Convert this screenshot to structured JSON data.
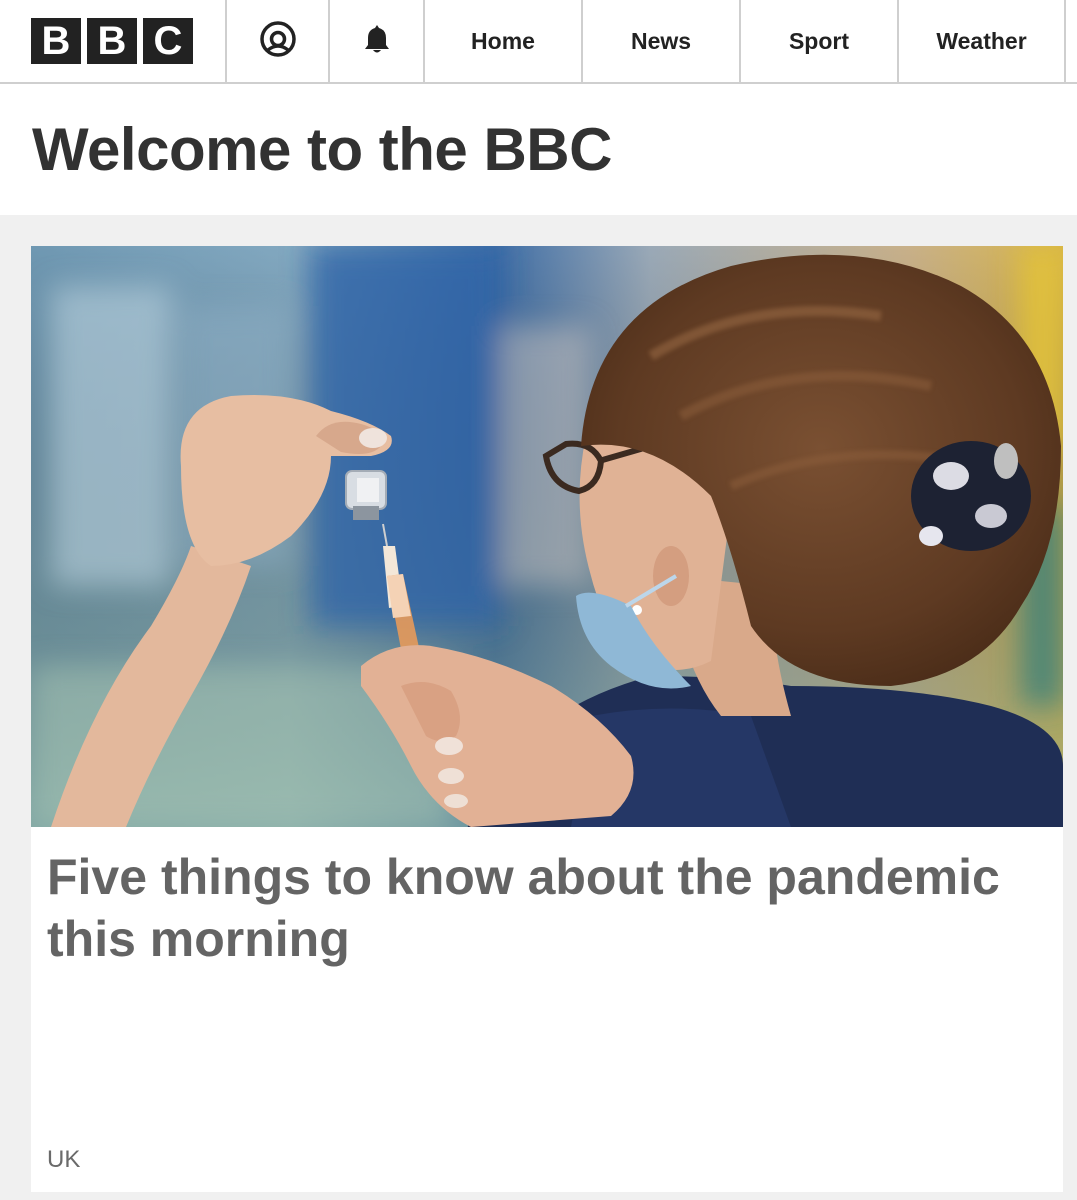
{
  "header": {
    "logo_letters": [
      "B",
      "B",
      "C"
    ],
    "icons": {
      "account": "account-icon",
      "notifications": "bell-icon"
    },
    "nav": [
      {
        "label": "Home"
      },
      {
        "label": "News"
      },
      {
        "label": "Sport"
      },
      {
        "label": "Weather"
      }
    ]
  },
  "page": {
    "title": "Welcome to the BBC"
  },
  "promo": {
    "image_subject": "vaccine-preparation-photo",
    "headline": "Five things to know about the pandemic this morning",
    "section": "UK"
  },
  "colors": {
    "logo_block": "#222222",
    "title_text": "#323232",
    "headline_text": "#646464",
    "page_background": "#f0f0f0"
  }
}
